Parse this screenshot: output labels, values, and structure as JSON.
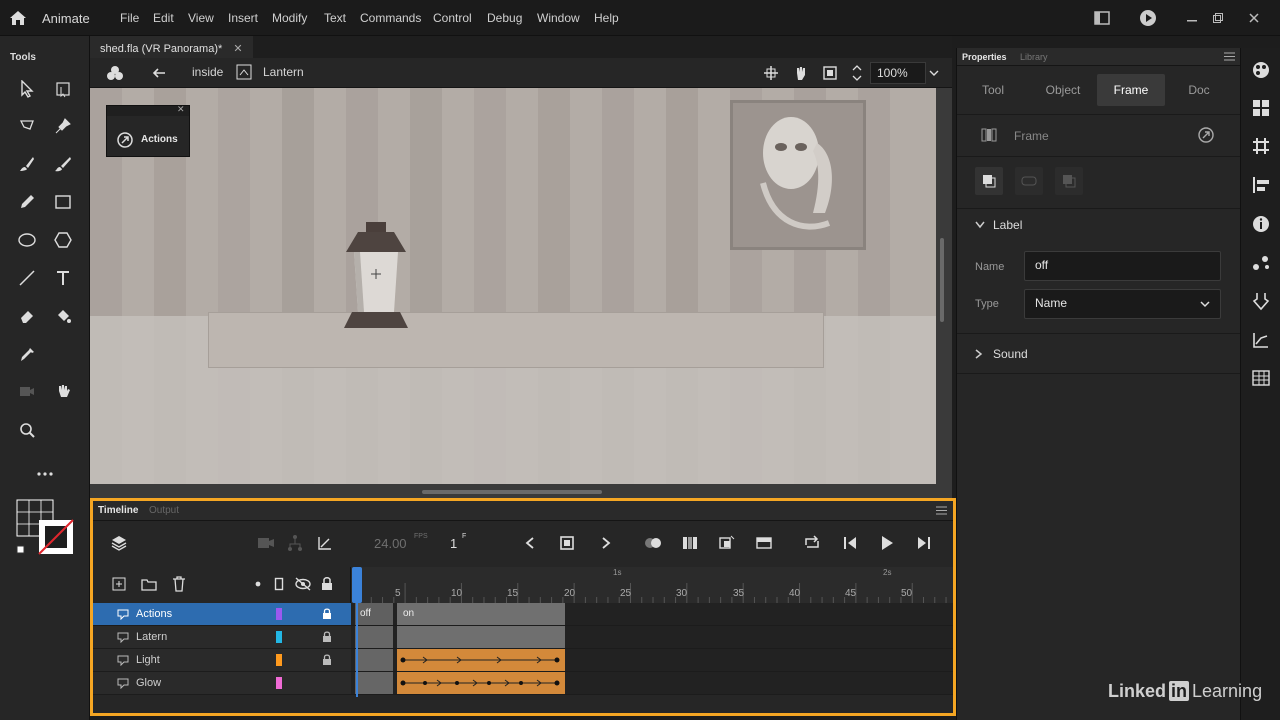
{
  "app": {
    "name": "Animate"
  },
  "menu": [
    "File",
    "Edit",
    "View",
    "Insert",
    "Modify",
    "Text",
    "Commands",
    "Control",
    "Debug",
    "Window",
    "Help"
  ],
  "tools": {
    "header": "Tools"
  },
  "document": {
    "tab_title": "shed.fla (VR Panorama)*"
  },
  "editbar": {
    "scene": "inside",
    "symbol": "Lantern",
    "zoom": "100%"
  },
  "stage": {
    "actions_panel_title": "Actions"
  },
  "timeline": {
    "tab_timeline": "Timeline",
    "tab_output": "Output",
    "fps": "24.00",
    "fps_unit": "FPS",
    "frame": "1",
    "frame_unit": "F",
    "ruler_numbers": [
      "5",
      "10",
      "15",
      "20",
      "25",
      "30",
      "35",
      "40",
      "45",
      "50"
    ],
    "ruler_seconds": [
      "1s",
      "2s"
    ],
    "layers": [
      {
        "name": "Actions",
        "color": "#9b59f0",
        "locked": true,
        "selected": true
      },
      {
        "name": "Latern",
        "color": "#23b7e5",
        "locked": true,
        "selected": false
      },
      {
        "name": "Light",
        "color": "#ff9a1e",
        "locked": true,
        "selected": false
      },
      {
        "name": "Glow",
        "color": "#f06ad5",
        "locked": false,
        "selected": false
      }
    ],
    "frame_labels": {
      "off": "off",
      "on": "on"
    }
  },
  "properties": {
    "tab_properties": "Properties",
    "tab_library": "Library",
    "subtabs": [
      "Tool",
      "Object",
      "Frame",
      "Doc"
    ],
    "active_subtab": "Frame",
    "section_title": "Frame",
    "label_section": "Label",
    "name_label": "Name",
    "name_value": "off",
    "type_label": "Type",
    "type_value": "Name",
    "sound_section": "Sound"
  },
  "watermark": {
    "linkedin": "Linked",
    "in": "in",
    "learning": "Learning"
  }
}
